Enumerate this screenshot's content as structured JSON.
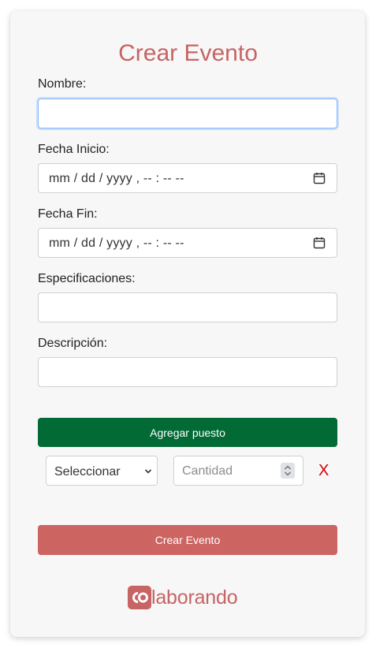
{
  "form": {
    "title": "Crear Evento",
    "fields": [
      {
        "label": "Nombre:",
        "value": ""
      },
      {
        "label": "Fecha Inicio:",
        "value": "mm / dd / yyyy ,  -- : --   --"
      },
      {
        "label": "Fecha Fin:",
        "value": "mm / dd / yyyy ,  -- : --   --"
      },
      {
        "label": "Especificaciones:",
        "value": ""
      },
      {
        "label": "Descripción:",
        "value": ""
      }
    ],
    "add_position_label": "Agregar puesto",
    "position_row": {
      "select_value": "Seleccionar",
      "quantity_placeholder": "Cantidad",
      "remove_label": "X"
    },
    "submit_label": "Crear Evento"
  },
  "brand": {
    "logo_mark": "co",
    "logo_text": "laborando",
    "color": "#c76464"
  },
  "colors": {
    "primary_green": "#016a35",
    "submit_red": "#cc6462",
    "remove_red": "#d40000"
  }
}
